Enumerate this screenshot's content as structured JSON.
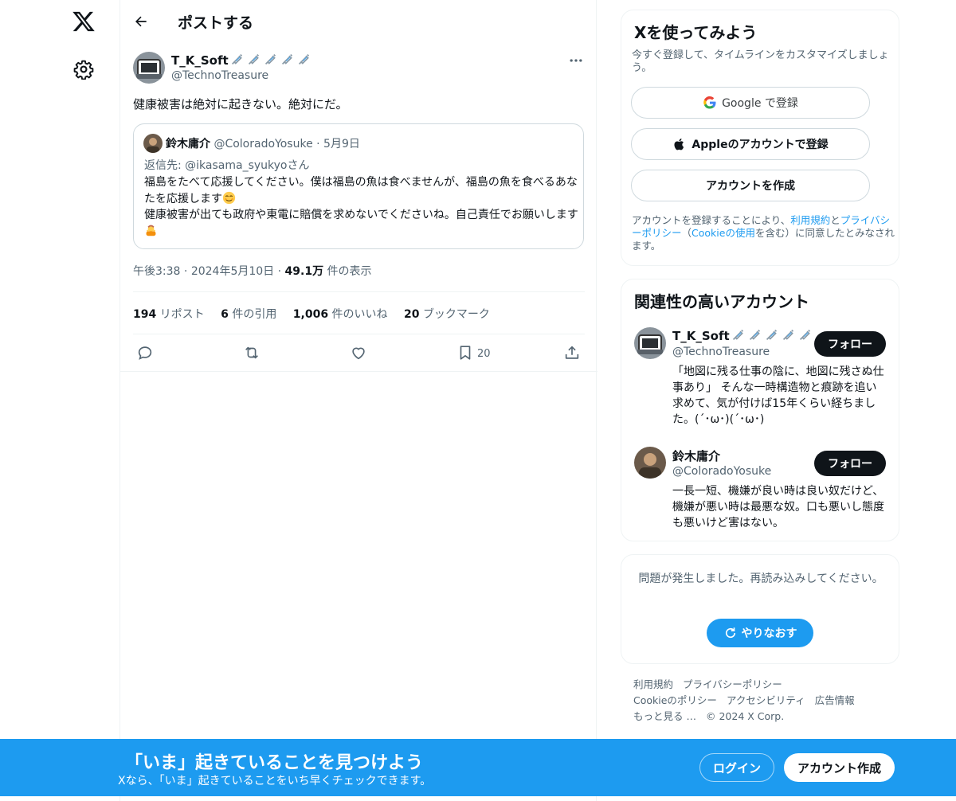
{
  "nav": {
    "logo_icon": "x-logo-icon",
    "settings_icon": "gear-icon"
  },
  "header": {
    "title": "ポストする"
  },
  "tweet": {
    "author_name": "T_K_Soft",
    "author_handle": "@TechnoTreasure",
    "text": "健康被害は絶対に起きない。絶対にだ。",
    "time": "午後3:38",
    "date": "2024年5月10日",
    "views_count": "49.1万",
    "views_label": "件の表示",
    "stats": {
      "reposts_count": "194",
      "reposts_label": "リポスト",
      "quotes_count": "6",
      "quotes_label": "件の引用",
      "likes_count": "1,006",
      "likes_label": "件のいいね",
      "bookmarks_count": "20",
      "bookmarks_label": "ブックマーク"
    },
    "bookmark_action_count": "20"
  },
  "quote": {
    "author_name": "鈴木庸介",
    "author_handle": "@ColoradoYosuke",
    "date": "5月9日",
    "reply_to": "返信先: @ikasama_syukyoさん",
    "line1": "福島をたべて応援してください。僕は福島の魚は食べませんが、福島の魚を食べるあなたを応援します",
    "line2": "健康被害が出ても政府や東電に賠償を求めないでくださいね。自己責任でお願いします"
  },
  "signup_card": {
    "title": "Xを使ってみよう",
    "subtitle": "今すぐ登録して、タイムラインをカスタマイズしましょう。",
    "google_label": "Google で登録",
    "apple_label": "Appleのアカウントで登録",
    "create_label": "アカウントを作成",
    "legal_1": "アカウントを登録することにより、",
    "legal_terms": "利用規約",
    "legal_2": "と",
    "legal_privacy": "プライバシーポリシー",
    "legal_3": "（",
    "legal_cookie": "Cookieの使用",
    "legal_4": "を含む）に同意したとみなされます。"
  },
  "related": {
    "title": "関連性の高いアカウント",
    "follow_label": "フォロー",
    "accounts": [
      {
        "name": "T_K_Soft",
        "handle": "@TechnoTreasure",
        "bio": "「地図に残る仕事の陰に、地図に残さぬ仕事あり」 そんな一時構造物と痕跡を追い求めて、気が付けば15年くらい経ちました。(´･ω･)(´･ω･)"
      },
      {
        "name": "鈴木庸介",
        "handle": "@ColoradoYosuke",
        "bio": "一長一短、機嫌が良い時は良い奴だけど、機嫌が悪い時は最悪な奴。口も悪いし態度も悪いけど害はない。"
      }
    ]
  },
  "error_card": {
    "message": "問題が発生しました。再読み込みしてください。",
    "retry_label": "やりなおす"
  },
  "footer": {
    "links": [
      "利用規約",
      "プライバシーポリシー",
      "Cookieのポリシー",
      "アクセシビリティ",
      "広告情報",
      "もっと見る …"
    ],
    "copyright": "© 2024 X Corp."
  },
  "bottom_bar": {
    "title": "「いま」起きていることを見つけよう",
    "subtitle": "Xなら、「いま」起きていることをいち早くチェックできます。",
    "login_label": "ログイン",
    "signup_label": "アカウント作成"
  },
  "colors": {
    "accent": "#1d9bf0",
    "text": "#0f1419",
    "muted": "#536471",
    "border": "#cfd9de"
  }
}
